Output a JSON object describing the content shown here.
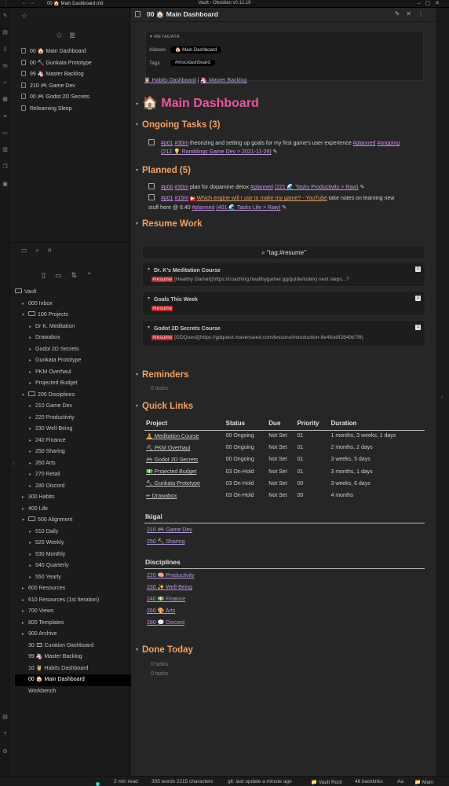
{
  "titlebar": {
    "tab": "00 🏠 Main Dashboard.md",
    "window_title": "Vault - Obsidian v0.12.19"
  },
  "sidebar": {
    "bookmarks": [
      {
        "label": "00 🏠 Main Dashboard"
      },
      {
        "label": "00 🔨 Gunkata Prototype"
      },
      {
        "label": "99 🦄 Master Backlog"
      },
      {
        "label": "210 🎮 Game Dev"
      },
      {
        "label": "00 🎮 Godot 2D Secrets"
      },
      {
        "label": "Relearning Sleep"
      }
    ],
    "tree": [
      {
        "label": "Vault",
        "depth": 0,
        "kind": "root"
      },
      {
        "label": "000 Inbox",
        "depth": 1,
        "kind": "folder"
      },
      {
        "label": "100 Projects",
        "depth": 1,
        "kind": "open"
      },
      {
        "label": "Dr K. Meditation",
        "depth": 2,
        "kind": "folder"
      },
      {
        "label": "Drawabox",
        "depth": 2,
        "kind": "folder"
      },
      {
        "label": "Godot 2D Secrets",
        "depth": 2,
        "kind": "folder"
      },
      {
        "label": "Gunkata Prototype",
        "depth": 2,
        "kind": "folder"
      },
      {
        "label": "PKM Overhaul",
        "depth": 2,
        "kind": "folder"
      },
      {
        "label": "Projected Budget",
        "depth": 2,
        "kind": "folder"
      },
      {
        "label": "200 Disciplines",
        "depth": 1,
        "kind": "open"
      },
      {
        "label": "210 Game Dev",
        "depth": 2,
        "kind": "folder"
      },
      {
        "label": "220 Productivity",
        "depth": 2,
        "kind": "folder"
      },
      {
        "label": "230 Well-Being",
        "depth": 2,
        "kind": "folder"
      },
      {
        "label": "240 Finance",
        "depth": 2,
        "kind": "folder"
      },
      {
        "label": "250 Sharing",
        "depth": 2,
        "kind": "folder"
      },
      {
        "label": "260 Arts",
        "depth": 2,
        "kind": "folder"
      },
      {
        "label": "270 Retail",
        "depth": 2,
        "kind": "folder"
      },
      {
        "label": "280 Discord",
        "depth": 2,
        "kind": "folder"
      },
      {
        "label": "300 Habits",
        "depth": 1,
        "kind": "folder"
      },
      {
        "label": "400 Life",
        "depth": 1,
        "kind": "folder"
      },
      {
        "label": "500 Alignment",
        "depth": 1,
        "kind": "open"
      },
      {
        "label": "510 Daily",
        "depth": 2,
        "kind": "folder"
      },
      {
        "label": "520 Weekly",
        "depth": 2,
        "kind": "folder"
      },
      {
        "label": "530 Monthly",
        "depth": 2,
        "kind": "folder"
      },
      {
        "label": "540 Quarterly",
        "depth": 2,
        "kind": "folder"
      },
      {
        "label": "550 Yearly",
        "depth": 2,
        "kind": "folder"
      },
      {
        "label": "600 Resources",
        "depth": 1,
        "kind": "folder"
      },
      {
        "label": "610 Resources (1st Iteration)",
        "depth": 1,
        "kind": "folder"
      },
      {
        "label": "700 Views",
        "depth": 1,
        "kind": "folder"
      },
      {
        "label": "800 Templates",
        "depth": 1,
        "kind": "folder"
      },
      {
        "label": "900 Archive",
        "depth": 1,
        "kind": "folder"
      },
      {
        "label": "30 🎞 Curation Dashboard",
        "depth": 1,
        "kind": "file"
      },
      {
        "label": "99 🦄 Master Backlog",
        "depth": 1,
        "kind": "file"
      },
      {
        "label": "10 🦉 Habits Dashboard",
        "depth": 1,
        "kind": "file"
      },
      {
        "label": "00 🏠 Main Dashboard",
        "depth": 1,
        "kind": "file",
        "active": true
      },
      {
        "label": "Workbench",
        "depth": 1,
        "kind": "file"
      }
    ]
  },
  "view": {
    "title": "00 🏠 Main Dashboard",
    "metadata": {
      "header": "▾ METADATA",
      "aliases_label": "Aliases",
      "aliases_value": "🏠 Main Dashboard",
      "tags_label": "Tags",
      "tags_value": "#moc/dashboard"
    },
    "links": {
      "habits": "🦉 Habits Dashboard",
      "sep": " | ",
      "backlog": "🦄 Master Backlog"
    },
    "page_title": "🏠 Main Dashboard",
    "ongoing": {
      "heading": "Ongoing Tasks (3)",
      "task": {
        "tag1": "#p01",
        "tag2": "#30m",
        "text": " theorizing and setting up goals for my first game's user experience ",
        "tag3": "#planned",
        "tag4": "#ongoing",
        "sub": "(212 💡 Ramblings Game Dev > 2021-11-29)"
      }
    },
    "planned": {
      "heading": "Planned (5)",
      "task1": {
        "tag1": "#p00",
        "tag2": "#30m",
        "text": " plan for dopamine detox ",
        "tag3": "#planned",
        "sub": "(221 🌊 Tasks Productivity > Raw)"
      },
      "task2": {
        "tag1": "#p01",
        "tag2": "#15m",
        "link": "Which engine will I use to make my game? - YouTube",
        "text": " take notes on learning new",
        "line2": "stuff here @ 6:40 ",
        "tag3": "#planned",
        "sub": "(401 🌊 Tasks Life > Raw)"
      }
    },
    "resume": {
      "heading": "Resume Work",
      "query": "\"tag:#resume\"",
      "cards": [
        {
          "title": "Dr. K's Meditation Course",
          "count": "1",
          "tag": "#resume",
          "text": " [Healthy Gamer](https://coaching.healthygamer.gg/guide/index) next steps...?"
        },
        {
          "title": "Goals This Week",
          "count": "1",
          "tag": "#resume",
          "text": ""
        },
        {
          "title": "Godot 2D Secrets Course",
          "count": "1",
          "tag": "#resume",
          "text": " [GDQuest](https://gdquest.mavenseed.com/lessons/introduction-8e4fce8f2840b7f8)"
        }
      ]
    },
    "reminders": {
      "heading": "Reminders",
      "count": "0 tasks"
    },
    "quick_links": {
      "heading": "Quick Links",
      "columns": [
        "Project",
        "Status",
        "Due",
        "Priority",
        "Duration"
      ],
      "rows": [
        [
          "🧘 Meditation Course",
          "00 Ongoing",
          "Not Set",
          "01",
          "1 months, 3 weeks, 1 days"
        ],
        [
          "⛏ PKM Overhaul",
          "00 Ongoing",
          "Not Set",
          "01",
          "2 months, 2 days"
        ],
        [
          "🎮 Godot 2D Secrets",
          "00 Ongoing",
          "Not Set",
          "01",
          "3 weeks, 5 days"
        ],
        [
          "💵 Projected Budget",
          "03 On-Hold",
          "Not Set",
          "01",
          "3 months, 1 days"
        ],
        [
          "🔨 Gunkata Prototype",
          "03 On-Hold",
          "Not Set",
          "00",
          "3 weeks, 6 days"
        ],
        [
          "✏ Drawabox",
          "03 On-Hold",
          "Not Set",
          "00",
          "4 months"
        ]
      ],
      "ikigai_heading": "Ikigai",
      "ikigai": [
        "210 🎮 Game Dev",
        "250 🔨 Sharing"
      ],
      "disciplines_heading": "Disciplines",
      "disciplines": [
        "220 🧠 Productivity",
        "230 ✨ Well-Being",
        "240 💵 Finance",
        "260 🎨 Arts",
        "280 💬 Discord"
      ]
    },
    "done": {
      "heading": "Done Today",
      "line1": "0 tasks",
      "line2": "0 tasks"
    }
  },
  "statusbar": {
    "read": "2 min read",
    "words": "305 words 2215 characters",
    "git": "git: last update a minute ago",
    "vault": "📁 Vault Root",
    "backlinks": "46 backlinks",
    "aa": "Aa",
    "branch": "📁 Main"
  }
}
